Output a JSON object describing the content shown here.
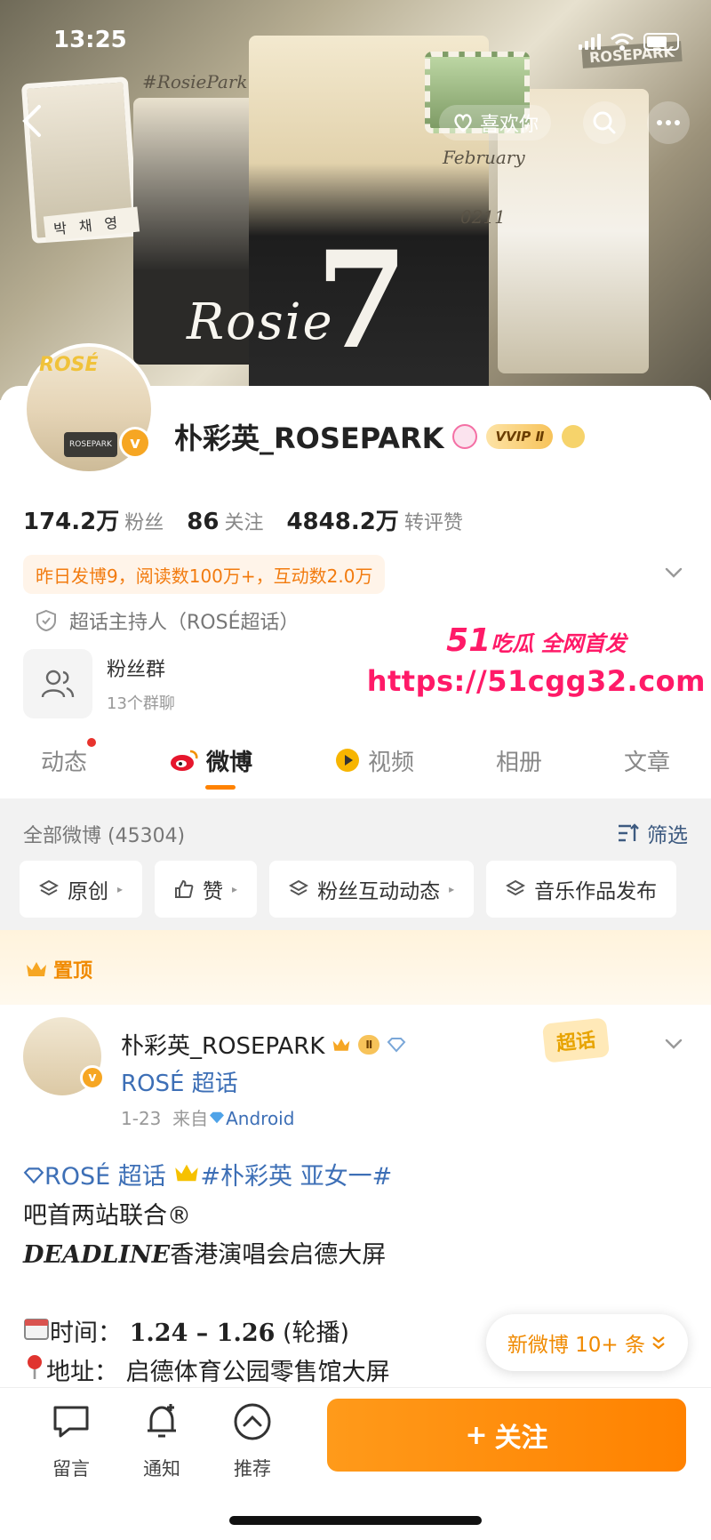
{
  "status_bar": {
    "time": "13:25"
  },
  "banner": {
    "like_label": "喜欢你",
    "tag_script": "#RosiePark",
    "tag_february": "February",
    "tag_date": "0211",
    "hangul_name": "박채영",
    "stamp_text": "ROSEPARK",
    "big_number": "7",
    "script_name": "Rosie"
  },
  "profile": {
    "avatar_text": "ROSÉ",
    "avatar_bag_text": "ROSEPARK",
    "verified_glyph": "v",
    "name": "朴彩英_ROSEPARK",
    "vip_label": "VVIP Ⅱ",
    "stats": [
      {
        "value": "174.2万",
        "label": "粉丝"
      },
      {
        "value": "86",
        "label": "关注"
      },
      {
        "value": "4848.2万",
        "label": "转评赞"
      }
    ],
    "activity": "昨日发博9，阅读数100万+，互动数2.0万",
    "host_role": "超话主持人（ROSÉ超话）",
    "group_name": "粉丝群",
    "group_count": "13个群聊"
  },
  "watermark": {
    "brand_num": "51",
    "brand_text": "吃瓜 全网首发",
    "url": "https://51cgg32.com"
  },
  "tabs": [
    {
      "label": "动态"
    },
    {
      "label": "微博"
    },
    {
      "label": "视频"
    },
    {
      "label": "相册"
    },
    {
      "label": "文章"
    }
  ],
  "filter": {
    "count_label": "全部微博 (45304)",
    "filter_label": "筛选",
    "chips": [
      "原创",
      "赞",
      "粉丝互动动态",
      "音乐作品发布"
    ]
  },
  "pinned_label": "置顶",
  "post": {
    "author": "朴彩英_ROSEPARK",
    "author_badge": "Ⅱ",
    "topic": "ROSÉ 超话",
    "date": "1-23",
    "from_label": "来自",
    "source": "Android",
    "chaohua_tag": "超话",
    "line1_topic": "ROSÉ 超话",
    "line1_hashtag": "#朴彩英 亚女一#",
    "line2": "吧首两站联合®",
    "line3_deadline": "DEADLINE",
    "line3_rest": "香港演唱会启德大屏",
    "time_label": "时间：",
    "time_value": "1.24 – 1.26",
    "time_note": "(轮播)",
    "addr_label": "地址：",
    "addr_value": "启德体育公园零售馆大屏"
  },
  "new_posts_label": "新微博 10+ 条",
  "bottom_bar": {
    "comment": "留言",
    "notify": "通知",
    "recommend": "推荐",
    "follow": "关注",
    "follow_plus": "+"
  },
  "colors": {
    "accent_orange": "#ff8200",
    "link_blue": "#3d6fb6",
    "watermark_pink": "#ff1a68"
  }
}
